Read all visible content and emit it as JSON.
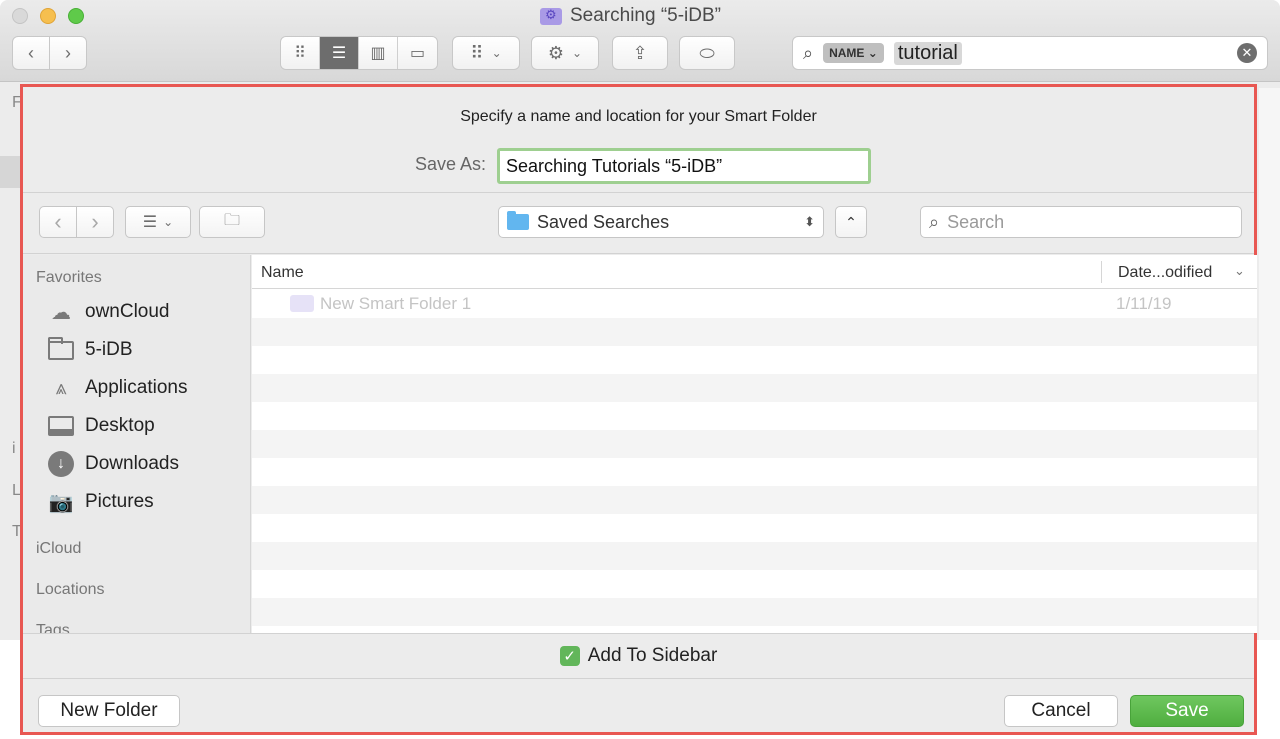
{
  "finder": {
    "title": "Searching “5-iDB”",
    "search": {
      "token": "NAME",
      "value": "tutorial"
    },
    "peek_letters": [
      "F",
      "i",
      "L",
      "T"
    ]
  },
  "dialog": {
    "prompt": "Specify a name and location for your Smart Folder",
    "save_as_label": "Save As:",
    "save_as_value": "Searching Tutorials “5-iDB”",
    "location": "Saved Searches",
    "search_placeholder": "Search",
    "sidebar": {
      "favorites_heading": "Favorites",
      "favorites": [
        {
          "label": "ownCloud",
          "icon": "cloud-icon"
        },
        {
          "label": "5-iDB",
          "icon": "folder-icon"
        },
        {
          "label": "Applications",
          "icon": "applications-icon"
        },
        {
          "label": "Desktop",
          "icon": "desktop-icon"
        },
        {
          "label": "Downloads",
          "icon": "download-icon"
        },
        {
          "label": "Pictures",
          "icon": "camera-icon"
        }
      ],
      "icloud_heading": "iCloud",
      "locations_heading": "Locations",
      "tags_heading": "Tags"
    },
    "columns": {
      "name": "Name",
      "date": "Date...odified"
    },
    "files": [
      {
        "name": "New Smart Folder 1",
        "date": "1/11/19"
      }
    ],
    "add_to_sidebar": {
      "label": "Add To Sidebar",
      "checked": true
    },
    "new_folder_label": "New Folder",
    "cancel_label": "Cancel",
    "save_label": "Save"
  },
  "colors": {
    "highlight_border": "#e85752",
    "save_button": "#5bb84b",
    "field_focus": "#9ecf90"
  }
}
